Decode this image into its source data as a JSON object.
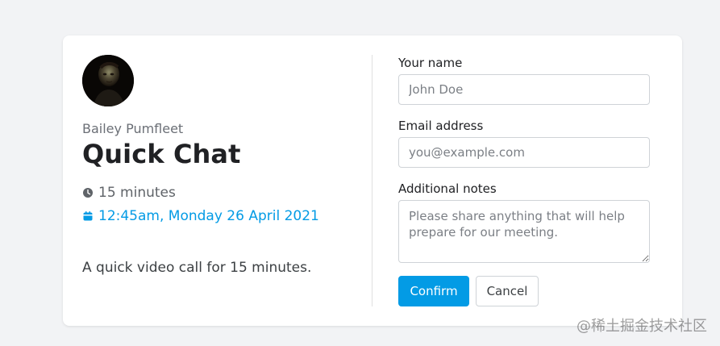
{
  "owner": {
    "name": "Bailey Pumfleet"
  },
  "event": {
    "title": "Quick Chat",
    "duration": "15 minutes",
    "datetime": "12:45am, Monday 26 April 2021",
    "description": "A quick video call for 15 minutes."
  },
  "icons": {
    "duration": "clock-icon",
    "datetime": "calendar-icon"
  },
  "form": {
    "name_label": "Your name",
    "name_placeholder": "John Doe",
    "email_label": "Email address",
    "email_placeholder": "you@example.com",
    "notes_label": "Additional notes",
    "notes_placeholder": "Please share anything that will help prepare for our meeting.",
    "confirm_label": "Confirm",
    "cancel_label": "Cancel"
  },
  "colors": {
    "accent": "#039be5",
    "background": "#f2f3f5",
    "card": "#ffffff"
  },
  "watermark": "@稀土掘金技术社区"
}
